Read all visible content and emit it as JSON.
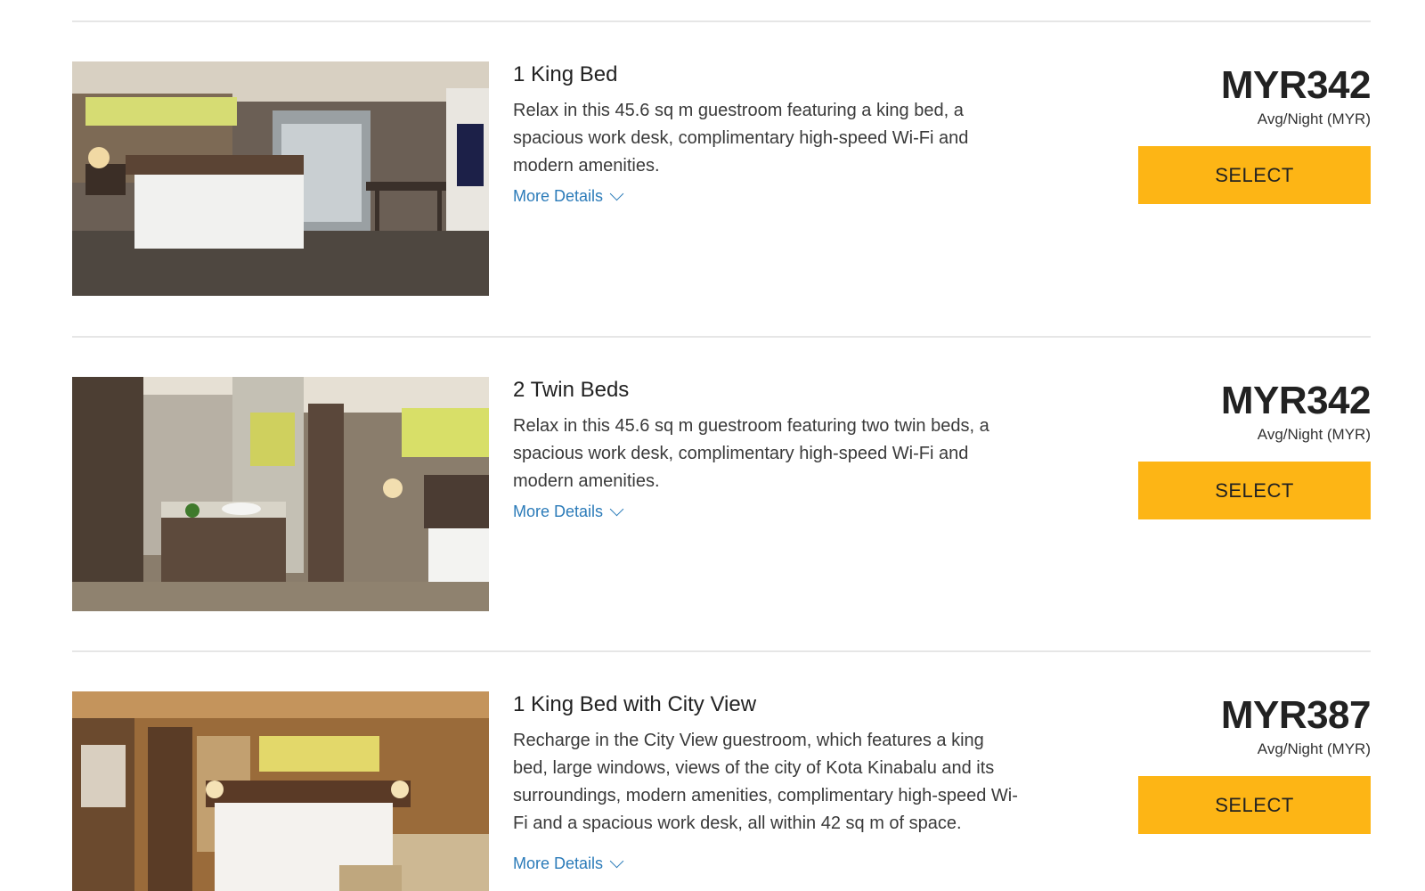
{
  "rooms": [
    {
      "title": "1 King Bed",
      "description": "Relax in this 45.6 sq m guestroom featuring a king bed, a spacious work desk, complimentary high-speed Wi-Fi and modern amenities.",
      "more_details_label": "More Details",
      "price": "MYR342",
      "price_note": "Avg/Night (MYR)",
      "select_label": "SELECT"
    },
    {
      "title": "2 Twin Beds",
      "description": "Relax in this 45.6 sq m guestroom featuring two twin beds, a spacious work desk, complimentary high-speed Wi-Fi and modern amenities.",
      "more_details_label": "More Details",
      "price": "MYR342",
      "price_note": "Avg/Night (MYR)",
      "select_label": "SELECT"
    },
    {
      "title": "1 King Bed with City View",
      "description": "Recharge in the City View guestroom, which features a king bed, large windows, views of the city of Kota Kinabalu and its surroundings, modern amenities, complimentary high-speed Wi-Fi and a spacious work desk, all within 42 sq m of space.",
      "more_details_label": "More Details",
      "price": "MYR387",
      "price_note": "Avg/Night (MYR)",
      "select_label": "SELECT"
    }
  ],
  "colors": {
    "accent_button": "#fdb515",
    "link": "#2b7bb9",
    "divider": "#e6e6e6"
  }
}
